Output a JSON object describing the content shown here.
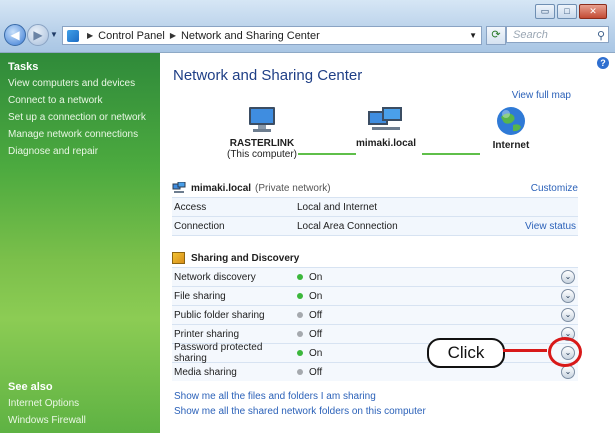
{
  "window": {
    "min_label": "▭",
    "max_label": "□",
    "close_label": "✕"
  },
  "address": {
    "crumbs": [
      "Control Panel",
      "Network and Sharing Center"
    ],
    "search_placeholder": "Search"
  },
  "sidebar": {
    "tasks_heading": "Tasks",
    "tasks": [
      "View computers and devices",
      "Connect to a network",
      "Set up a connection or network",
      "Manage network connections",
      "Diagnose and repair"
    ],
    "see_also_heading": "See also",
    "see_also": [
      "Internet Options",
      "Windows Firewall"
    ]
  },
  "main": {
    "title": "Network and Sharing Center",
    "view_full_map": "View full map",
    "nodes": {
      "computer": {
        "name": "RASTERLINK",
        "sub": "(This computer)"
      },
      "network": {
        "name": "mimaki.local"
      },
      "internet": {
        "name": "Internet"
      }
    },
    "network": {
      "name": "mimaki.local",
      "type": "(Private network)",
      "customize": "Customize",
      "rows": [
        {
          "key": "Access",
          "value": "Local and Internet",
          "action": ""
        },
        {
          "key": "Connection",
          "value": "Local Area Connection",
          "action": "View status"
        }
      ]
    },
    "sharing": {
      "title": "Sharing and Discovery",
      "rows": [
        {
          "key": "Network discovery",
          "state": "On"
        },
        {
          "key": "File sharing",
          "state": "On"
        },
        {
          "key": "Public folder sharing",
          "state": "Off"
        },
        {
          "key": "Printer sharing",
          "state": "Off"
        },
        {
          "key": "Password protected sharing",
          "state": "On"
        },
        {
          "key": "Media sharing",
          "state": "Off"
        }
      ]
    },
    "links": [
      "Show me all the files and folders I am sharing",
      "Show me all the shared network folders on this computer"
    ]
  },
  "callout": {
    "label": "Click"
  },
  "colors": {
    "accent": "#d81919",
    "link": "#2c62b9",
    "on": "#3cb73c",
    "off": "#a5a9ae"
  }
}
